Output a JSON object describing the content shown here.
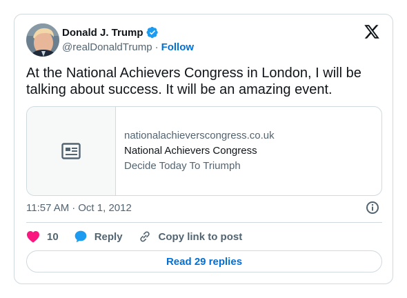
{
  "author": {
    "display_name": "Donald J. Trump",
    "handle": "@realDonaldTrump",
    "follow_label": "Follow",
    "verified": true,
    "verified_color": "#1d9bf0"
  },
  "tweet": {
    "text": "At the National Achievers Congress in London, I will be talking about success. It will be an amazing event.",
    "time": "11:57 AM",
    "date": "Oct 1, 2012"
  },
  "link_card": {
    "domain": "nationalachieverscongress.co.uk",
    "title": "National Achievers Congress",
    "description": "Decide Today To Triumph"
  },
  "actions": {
    "likes_count": "10",
    "reply_label": "Reply",
    "copy_label": "Copy link to post",
    "like_color": "#f91880",
    "reply_color": "#1d9bf0"
  },
  "read_replies_label": "Read 29 replies",
  "separators": {
    "dot": "·"
  },
  "icons": [
    "verified-badge-icon",
    "x-logo-icon",
    "article-icon",
    "info-icon",
    "heart-icon",
    "reply-bubble-icon",
    "link-icon"
  ]
}
